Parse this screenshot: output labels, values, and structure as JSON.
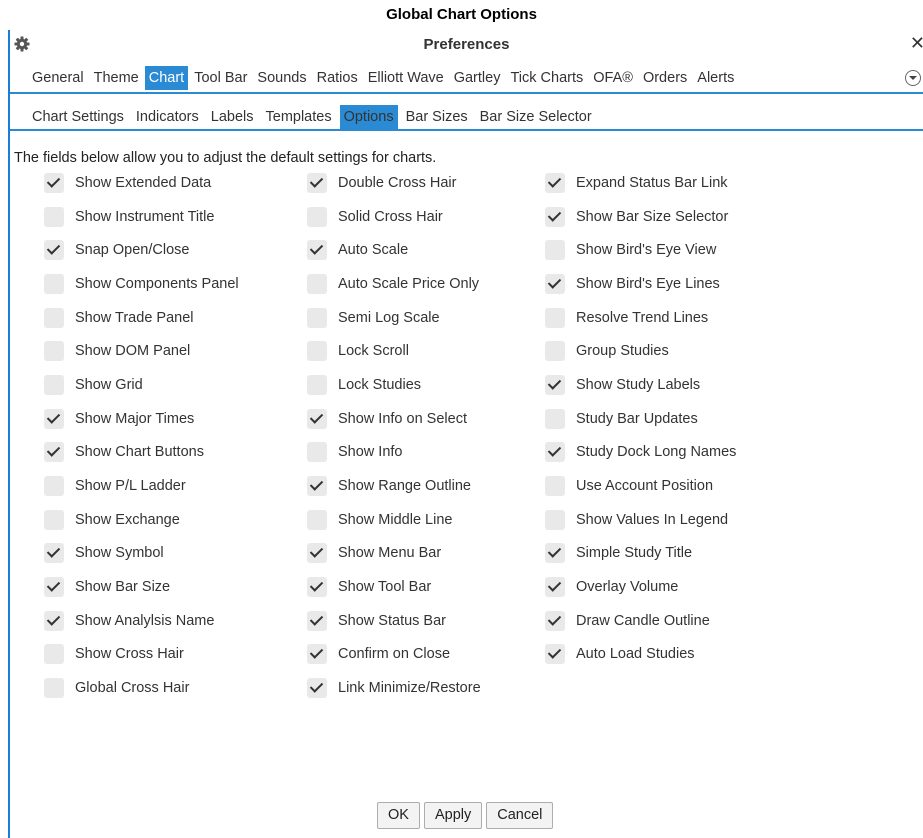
{
  "caption": "Global Chart Options",
  "window": {
    "title": "Preferences"
  },
  "main_tabs": [
    "General",
    "Theme",
    "Chart",
    "Tool Bar",
    "Sounds",
    "Ratios",
    "Elliott Wave",
    "Gartley",
    "Tick Charts",
    "OFA®",
    "Orders",
    "Alerts"
  ],
  "main_tabs_active": "Chart",
  "sub_tabs": [
    "Chart Settings",
    "Indicators",
    "Labels",
    "Templates",
    "Options",
    "Bar Sizes",
    "Bar Size Selector"
  ],
  "sub_tabs_active": "Options",
  "intro": "The fields below allow you to adjust the default settings for charts.",
  "columns": [
    [
      {
        "label": "Show Extended Data",
        "checked": true
      },
      {
        "label": "Show Instrument Title",
        "checked": false
      },
      {
        "label": "Snap Open/Close",
        "checked": true
      },
      {
        "label": "Show Components Panel",
        "checked": false
      },
      {
        "label": "Show Trade Panel",
        "checked": false
      },
      {
        "label": "Show DOM Panel",
        "checked": false
      },
      {
        "label": "Show Grid",
        "checked": false
      },
      {
        "label": "Show Major Times",
        "checked": true
      },
      {
        "label": "Show Chart Buttons",
        "checked": true
      },
      {
        "label": "Show P/L Ladder",
        "checked": false
      },
      {
        "label": "Show Exchange",
        "checked": false
      },
      {
        "label": "Show Symbol",
        "checked": true
      },
      {
        "label": "Show Bar Size",
        "checked": true
      },
      {
        "label": "Show Analylsis Name",
        "checked": true
      },
      {
        "label": "Show Cross Hair",
        "checked": false
      },
      {
        "label": "Global Cross Hair",
        "checked": false
      }
    ],
    [
      {
        "label": "Double Cross Hair",
        "checked": true
      },
      {
        "label": "Solid Cross Hair",
        "checked": false
      },
      {
        "label": "Auto Scale",
        "checked": true
      },
      {
        "label": "Auto Scale Price Only",
        "checked": false
      },
      {
        "label": "Semi Log Scale",
        "checked": false
      },
      {
        "label": "Lock Scroll",
        "checked": false
      },
      {
        "label": "Lock Studies",
        "checked": false
      },
      {
        "label": "Show Info on Select",
        "checked": true
      },
      {
        "label": "Show Info",
        "checked": false
      },
      {
        "label": "Show Range Outline",
        "checked": true
      },
      {
        "label": "Show Middle Line",
        "checked": false
      },
      {
        "label": "Show Menu Bar",
        "checked": true
      },
      {
        "label": "Show Tool Bar",
        "checked": true
      },
      {
        "label": "Show Status Bar",
        "checked": true
      },
      {
        "label": "Confirm on Close",
        "checked": true
      },
      {
        "label": "Link Minimize/Restore",
        "checked": true
      }
    ],
    [
      {
        "label": "Expand Status Bar Link",
        "checked": true
      },
      {
        "label": "Show Bar Size Selector",
        "checked": true
      },
      {
        "label": "Show Bird's Eye View",
        "checked": false
      },
      {
        "label": "Show Bird's Eye Lines",
        "checked": true
      },
      {
        "label": "Resolve Trend Lines",
        "checked": false
      },
      {
        "label": "Group Studies",
        "checked": false
      },
      {
        "label": "Show Study Labels",
        "checked": true
      },
      {
        "label": "Study Bar Updates",
        "checked": false
      },
      {
        "label": "Study Dock Long Names",
        "checked": true
      },
      {
        "label": "Use Account Position",
        "checked": false
      },
      {
        "label": "Show Values In Legend",
        "checked": false
      },
      {
        "label": "Simple Study Title",
        "checked": true
      },
      {
        "label": "Overlay Volume",
        "checked": true
      },
      {
        "label": "Draw Candle Outline",
        "checked": true
      },
      {
        "label": "Auto Load Studies",
        "checked": true
      }
    ]
  ],
  "buttons": {
    "ok": "OK",
    "apply": "Apply",
    "cancel": "Cancel"
  },
  "colors": {
    "accent": "#2a8ad4",
    "checkbox_bg": "#e9e9e9"
  }
}
